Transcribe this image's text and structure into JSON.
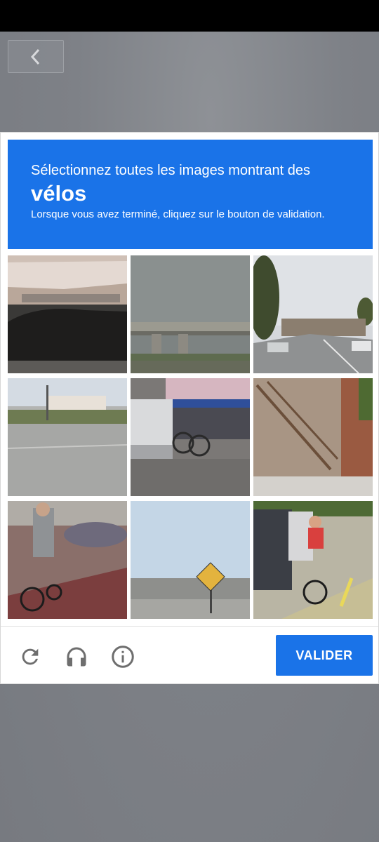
{
  "captcha": {
    "instruction_line1": "Sélectionnez toutes les images montrant des",
    "target_word": "vélos",
    "instruction_line3": "Lorsque vous avez terminé, cliquez sur le bouton de validation.",
    "header_color": "#1a73e8",
    "tiles": [
      {
        "description_icon": "image-tile"
      },
      {
        "description_icon": "image-tile"
      },
      {
        "description_icon": "image-tile"
      },
      {
        "description_icon": "image-tile"
      },
      {
        "description_icon": "image-tile"
      },
      {
        "description_icon": "image-tile"
      },
      {
        "description_icon": "image-tile"
      },
      {
        "description_icon": "image-tile"
      },
      {
        "description_icon": "image-tile"
      }
    ],
    "footer": {
      "reload_icon": "reload-icon",
      "audio_icon": "headphones-icon",
      "info_icon": "info-icon",
      "validate_label": "VALIDER"
    }
  },
  "nav": {
    "back_icon": "chevron-left-icon"
  }
}
